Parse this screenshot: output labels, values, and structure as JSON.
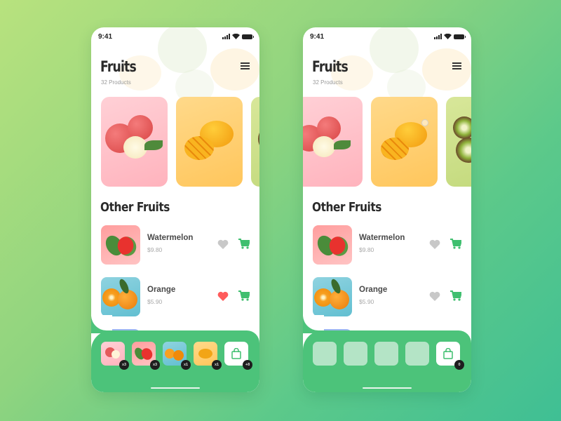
{
  "phones": [
    {
      "id": "left",
      "status": {
        "time": "9:41"
      },
      "header": {
        "title": "Fruits",
        "subtitle": "32 Products",
        "filter_icon": "sliders-icon"
      },
      "featured": [
        {
          "name": "Apple",
          "color": "#ffb3bd"
        },
        {
          "name": "Mango",
          "color": "#ffc65c"
        },
        {
          "name": "Kiwi",
          "color": "#c2d97b"
        }
      ],
      "section_title": "Other Fruits",
      "products": [
        {
          "name": "Watermelon",
          "price": "$9.80",
          "favorite": false
        },
        {
          "name": "Orange",
          "price": "$5.90",
          "favorite": true
        }
      ],
      "cart_tray": {
        "items": [
          {
            "fruit": "Apple",
            "qty": "x3"
          },
          {
            "fruit": "Watermelon",
            "qty": "x3"
          },
          {
            "fruit": "Orange",
            "qty": "x1"
          },
          {
            "fruit": "Mango",
            "qty": "x1"
          }
        ],
        "bag_count": "+8"
      }
    },
    {
      "id": "right",
      "status": {
        "time": "9:41"
      },
      "header": {
        "title": "Fruits",
        "subtitle": "32 Products",
        "filter_icon": "sliders-icon"
      },
      "featured": [
        {
          "name": "Apple",
          "color": "#ffb3bd"
        },
        {
          "name": "Mango",
          "color": "#ffc65c"
        },
        {
          "name": "Kiwi",
          "color": "#c2d97b"
        }
      ],
      "section_title": "Other Fruits",
      "products": [
        {
          "name": "Watermelon",
          "price": "$9.80",
          "favorite": false
        },
        {
          "name": "Orange",
          "price": "$5.90",
          "favorite": false
        }
      ],
      "cart_tray": {
        "items": [],
        "empty_slots": 4,
        "bag_count": "0"
      }
    }
  ],
  "colors": {
    "accent_green": "#4cc37a",
    "heart_active": "#ff5b5b",
    "heart_inactive": "#c8c8c8",
    "cart_icon": "#3fbf6f",
    "empty_slot": "#b4e4c6"
  }
}
